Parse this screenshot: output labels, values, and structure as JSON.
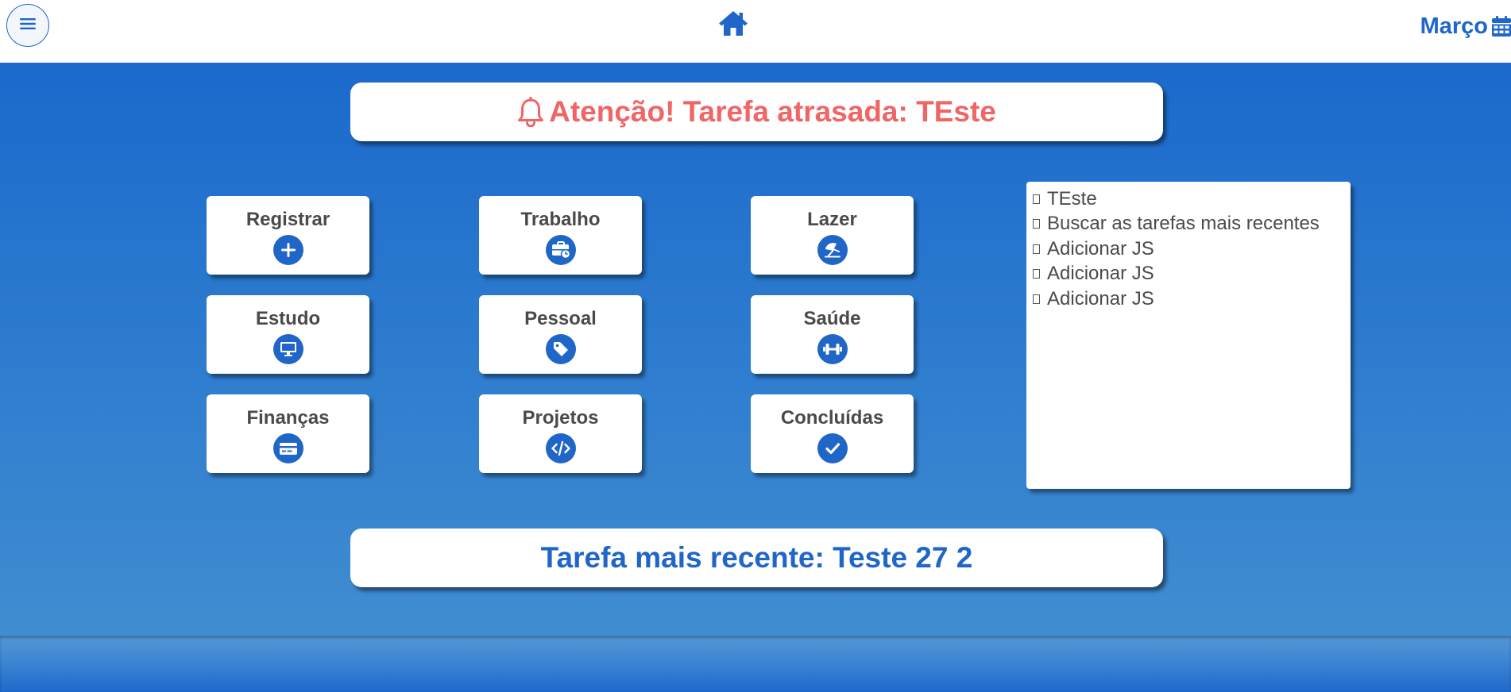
{
  "header": {
    "menu_icon": "hamburger-icon",
    "home_icon": "home-icon",
    "month_label": "Março",
    "calendar_icon": "calendar-icon"
  },
  "alert": {
    "icon": "bell-icon",
    "text": "Atenção! Tarefa atrasada: TEste",
    "color": "#f06666"
  },
  "categories": [
    {
      "label": "Registrar",
      "icon": "plus-icon"
    },
    {
      "label": "Trabalho",
      "icon": "briefcase-clock-icon"
    },
    {
      "label": "Lazer",
      "icon": "umbrella-beach-icon"
    },
    {
      "label": "Estudo",
      "icon": "desktop-icon"
    },
    {
      "label": "Pessoal",
      "icon": "tag-icon"
    },
    {
      "label": "Saúde",
      "icon": "dumbbell-icon"
    },
    {
      "label": "Finanças",
      "icon": "credit-card-icon"
    },
    {
      "label": "Projetos",
      "icon": "code-icon"
    },
    {
      "label": "Concluídas",
      "icon": "check-icon"
    }
  ],
  "task_list": {
    "items": [
      "TEste",
      "Buscar as tarefas mais recentes",
      "Adicionar JS",
      "Adicionar JS",
      "Adicionar JS"
    ]
  },
  "recent": {
    "text": "Tarefa mais recente: Teste 27 2"
  },
  "colors": {
    "accent": "#1f66c8",
    "alert": "#f06666",
    "text": "#4a4a4a"
  }
}
